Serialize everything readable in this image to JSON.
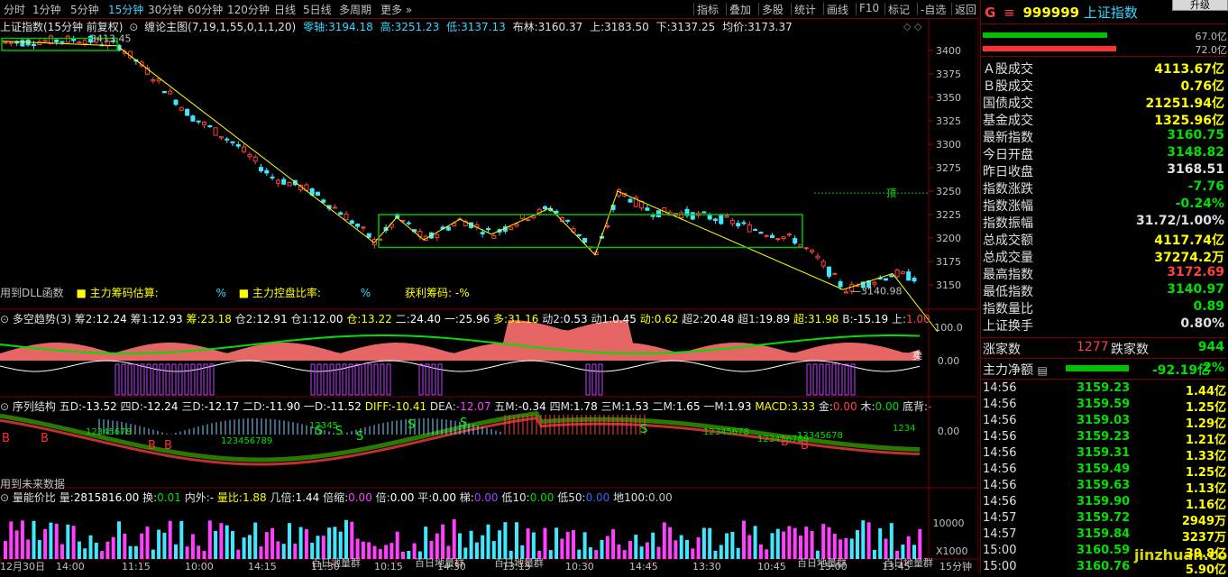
{
  "toolbar": {
    "periods": [
      "分时",
      "1分钟",
      "5分钟",
      "15分钟",
      "30分钟",
      "60分钟",
      "120分钟",
      "日线",
      "5日线",
      "多周期",
      "更多"
    ],
    "active_period": "15分钟",
    "tools": [
      "指标",
      "叠加",
      "多股",
      "统计",
      "画线",
      "F10",
      "标记",
      "-自选",
      "返回"
    ]
  },
  "main": {
    "title": "上证指数(15分钟 前复权)",
    "indicator": "缠论主图(7,19,1,55,0,1,1,20)",
    "zero_axis_label": "零轴:",
    "zero_axis": "3194.18",
    "high_label": "高:",
    "high": "3251.23",
    "low_label": "低:",
    "low": "3137.13",
    "boll_label": "布林:",
    "boll": "3160.37",
    "up_label": "上:",
    "up": "3183.50",
    "down_label": "下:",
    "down": "3137.25",
    "avg_label": "均价:",
    "avg": "3173.37",
    "peak_label": "3413.45",
    "low_mark": "3140.98",
    "top_mark": "顶",
    "dll_note": "用到DLL函数",
    "chip1": "主力筹码估算:",
    "chip1_unit": "%",
    "chip2": "主力控盘比率:",
    "chip2_unit": "%",
    "chip3": "获利筹码: -%",
    "y_ticks": [
      "3400",
      "3375",
      "3350",
      "3325",
      "3300",
      "3275",
      "3250",
      "3225",
      "3200",
      "3175",
      "3150"
    ]
  },
  "panel2": {
    "title": "多空趋势(3)",
    "items": [
      {
        "label": "筹2:",
        "val": "12.24",
        "color": "#ffffff"
      },
      {
        "label": "筹1:",
        "val": "12.93",
        "color": "#ffffff"
      },
      {
        "label": "筹:",
        "val": "23.18",
        "color": "#ffff00"
      },
      {
        "label": "仓2:",
        "val": "12.91",
        "color": "#ffffff"
      },
      {
        "label": "仓1:",
        "val": "12.00",
        "color": "#ffffff"
      },
      {
        "label": "仓:",
        "val": "13.22",
        "color": "#ffff00"
      },
      {
        "label": "二:",
        "val": "24.40",
        "color": "#ffffff"
      },
      {
        "label": "一:",
        "val": "25.96",
        "color": "#ffffff"
      },
      {
        "label": "多:",
        "val": "31.16",
        "color": "#ffff00"
      },
      {
        "label": "动2:",
        "val": "0.53",
        "color": "#ffffff"
      },
      {
        "label": "动1:",
        "val": "0.45",
        "color": "#ffffff"
      },
      {
        "label": "动:",
        "val": "0.62",
        "color": "#ffff00"
      },
      {
        "label": "超2:",
        "val": "20.48",
        "color": "#ffffff"
      },
      {
        "label": "超1:",
        "val": "19.89",
        "color": "#ffffff"
      },
      {
        "label": "超:",
        "val": "31.98",
        "color": "#ffff00"
      },
      {
        "label": "B:",
        "val": "-15.19",
        "color": "#ffffff"
      },
      {
        "label": "上:",
        "val": "1.00",
        "color": "#ff4040"
      }
    ],
    "y_ticks": [
      "100.0",
      "0.00"
    ],
    "mark_sell": "卖"
  },
  "panel3": {
    "title": "序列结构",
    "items": [
      {
        "label": "五D:",
        "val": "-13.52",
        "color": "#ffffff"
      },
      {
        "label": "四D:",
        "val": "-12.24",
        "color": "#ffffff"
      },
      {
        "label": "三D:",
        "val": "-12.17",
        "color": "#ffffff"
      },
      {
        "label": "二D:",
        "val": "-11.90",
        "color": "#ffffff"
      },
      {
        "label": "一D:",
        "val": "-11.52",
        "color": "#ffffff"
      },
      {
        "label": "DIFF:",
        "val": "-10.41",
        "color": "#ffff00"
      },
      {
        "label": "DEA:",
        "val": "-12.07",
        "color": "#ff40ff"
      },
      {
        "label": "五M:",
        "val": "-0.34",
        "color": "#ffffff"
      },
      {
        "label": "四M:",
        "val": "1.78",
        "color": "#ffffff"
      },
      {
        "label": "三M:",
        "val": "1.53",
        "color": "#ffffff"
      },
      {
        "label": "二M:",
        "val": "1.65",
        "color": "#ffffff"
      },
      {
        "label": "一M:",
        "val": "1.93",
        "color": "#ffffff"
      },
      {
        "label": "MACD:",
        "val": "3.33",
        "color": "#ffff00"
      },
      {
        "label": "金:",
        "val": "0.00",
        "color": "#ff4040"
      },
      {
        "label": "木:",
        "val": "0.00",
        "color": "#00e000"
      },
      {
        "label": "底背:",
        "val": "-",
        "color": "#ff4040"
      }
    ],
    "y_ticks": [
      "0.00"
    ],
    "future_note": "用到未来数据",
    "seq_marks": [
      "12345678",
      "12345",
      "123456789",
      "12345678",
      "123456789",
      "12345678",
      "1234"
    ],
    "b_mark": "B",
    "s_mark": "S"
  },
  "panel4": {
    "title": "量能价比",
    "items": [
      {
        "label": "量:",
        "val": "2815816.00",
        "color": "#ffffff"
      },
      {
        "label": "换:",
        "val": "0.01",
        "color": "#00e000"
      },
      {
        "label": "内外:",
        "val": "-",
        "color": "#ffffff"
      },
      {
        "label": "量比:",
        "val": "1.88",
        "color": "#ffff00"
      },
      {
        "label": "几倍:",
        "val": "1.44",
        "color": "#ffffff"
      },
      {
        "label": "倍缩:",
        "val": "0.00",
        "color": "#ff40ff"
      },
      {
        "label": "倍:",
        "val": "0.00",
        "color": "#ffffff"
      },
      {
        "label": "平:",
        "val": "0.00",
        "color": "#ffffff"
      },
      {
        "label": "梯:",
        "val": "0.00",
        "color": "#a040ff"
      },
      {
        "label": "低10:",
        "val": "0.00",
        "color": "#00e000"
      },
      {
        "label": "低50:",
        "val": "0.00",
        "color": "#4060ff"
      },
      {
        "label": "地100:",
        "val": "0.00",
        "color": "#c0c0c0"
      }
    ],
    "y_ticks": [
      "10000"
    ],
    "unit": "X1000",
    "watermark": "百日地量群"
  },
  "time_axis": {
    "labels": [
      "12月30日",
      "14:00",
      "11:15",
      "10:00",
      "14:15",
      "11:30",
      "10:15",
      "14:30",
      "13:15",
      "10:30",
      "14:45",
      "13:30",
      "10:45",
      "15:00",
      "13:45"
    ],
    "period": "15分钟"
  },
  "quote": {
    "flag": "G",
    "code": "999999",
    "name": "上证指数",
    "ratio1": "67.0亿",
    "ratio2": "72.0亿",
    "rows": [
      {
        "label": "Ａ股成交",
        "val": "4113.67亿",
        "color": "#ffff00"
      },
      {
        "label": "Ｂ股成交",
        "val": "0.76亿",
        "color": "#ffff00"
      },
      {
        "label": "国债成交",
        "val": "21251.94亿",
        "color": "#ffff00"
      },
      {
        "label": "基金成交",
        "val": "1325.96亿",
        "color": "#ffff00"
      },
      {
        "label": "最新指数",
        "val": "3160.75",
        "color": "#00e000"
      },
      {
        "label": "今日开盘",
        "val": "3148.82",
        "color": "#00e000"
      },
      {
        "label": "昨日收盘",
        "val": "3168.51",
        "color": "#e0e0e0"
      },
      {
        "label": "指数涨跌",
        "val": "-7.76",
        "color": "#00e000"
      },
      {
        "label": "指数涨幅",
        "val": "-0.24%",
        "color": "#00e000"
      },
      {
        "label": "指数振幅",
        "val": "31.72/1.00%",
        "color": "#e0e0e0"
      },
      {
        "label": "总成交额",
        "val": "4117.74亿",
        "color": "#ffff00"
      },
      {
        "label": "总成交量",
        "val": "37274.2万",
        "color": "#ffff00"
      },
      {
        "label": "最高指数",
        "val": "3172.69",
        "color": "#ff4040"
      },
      {
        "label": "最低指数",
        "val": "3140.97",
        "color": "#00e000"
      },
      {
        "label": "指数量比",
        "val": "0.89",
        "color": "#00e000"
      },
      {
        "label": "上证换手",
        "val": "0.80%",
        "color": "#e0e0e0"
      }
    ],
    "rise_label": "涨家数",
    "rise": "1277",
    "fall_label": "跌家数",
    "fall": "944",
    "net_label": "主力净额",
    "net_val": "-92.19亿",
    "net_pct": "-2%",
    "ticks": [
      {
        "t": "14:56",
        "p": "3159.23",
        "v": "1.44亿"
      },
      {
        "t": "14:56",
        "p": "3159.59",
        "v": "1.25亿"
      },
      {
        "t": "14:56",
        "p": "3159.03",
        "v": "1.29亿"
      },
      {
        "t": "14:56",
        "p": "3159.23",
        "v": "1.21亿"
      },
      {
        "t": "14:56",
        "p": "3159.31",
        "v": "1.33亿"
      },
      {
        "t": "14:56",
        "p": "3159.49",
        "v": "1.25亿"
      },
      {
        "t": "14:56",
        "p": "3159.63",
        "v": "1.13亿"
      },
      {
        "t": "14:56",
        "p": "3159.90",
        "v": "1.16亿"
      },
      {
        "t": "14:57",
        "p": "3159.72",
        "v": "2949万"
      },
      {
        "t": "14:57",
        "p": "3159.84",
        "v": "3237万"
      },
      {
        "t": "15:00",
        "p": "3160.59",
        "v": "39.8亿"
      },
      {
        "t": "15:00",
        "p": "3160.76",
        "v": "5.90亿"
      }
    ],
    "corner_btn": "升级",
    "watermark": "jinzhuan.com"
  }
}
